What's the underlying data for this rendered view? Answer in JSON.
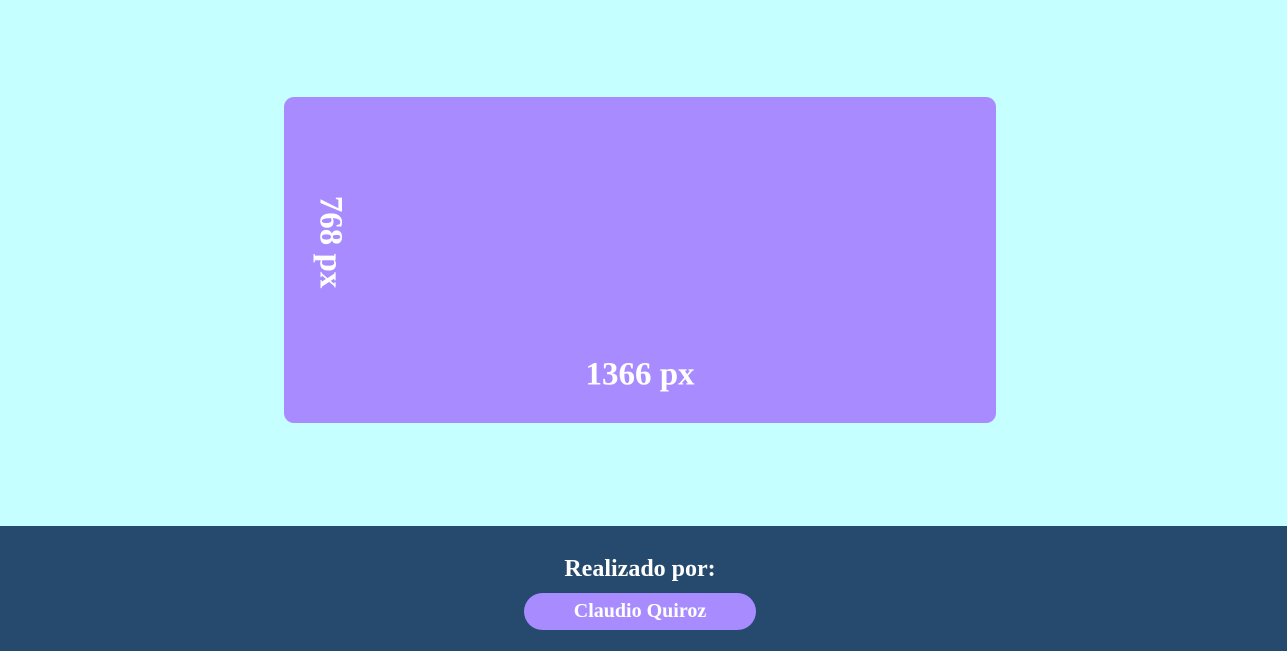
{
  "screen": {
    "height_label": "768 px",
    "width_label": "1366 px"
  },
  "footer": {
    "title": "Realizado por:",
    "author": "Claudio Quiroz"
  },
  "colors": {
    "background": "#c5ffff",
    "box": "#a78bff",
    "footer": "#254a6e",
    "text": "#ffffff"
  }
}
